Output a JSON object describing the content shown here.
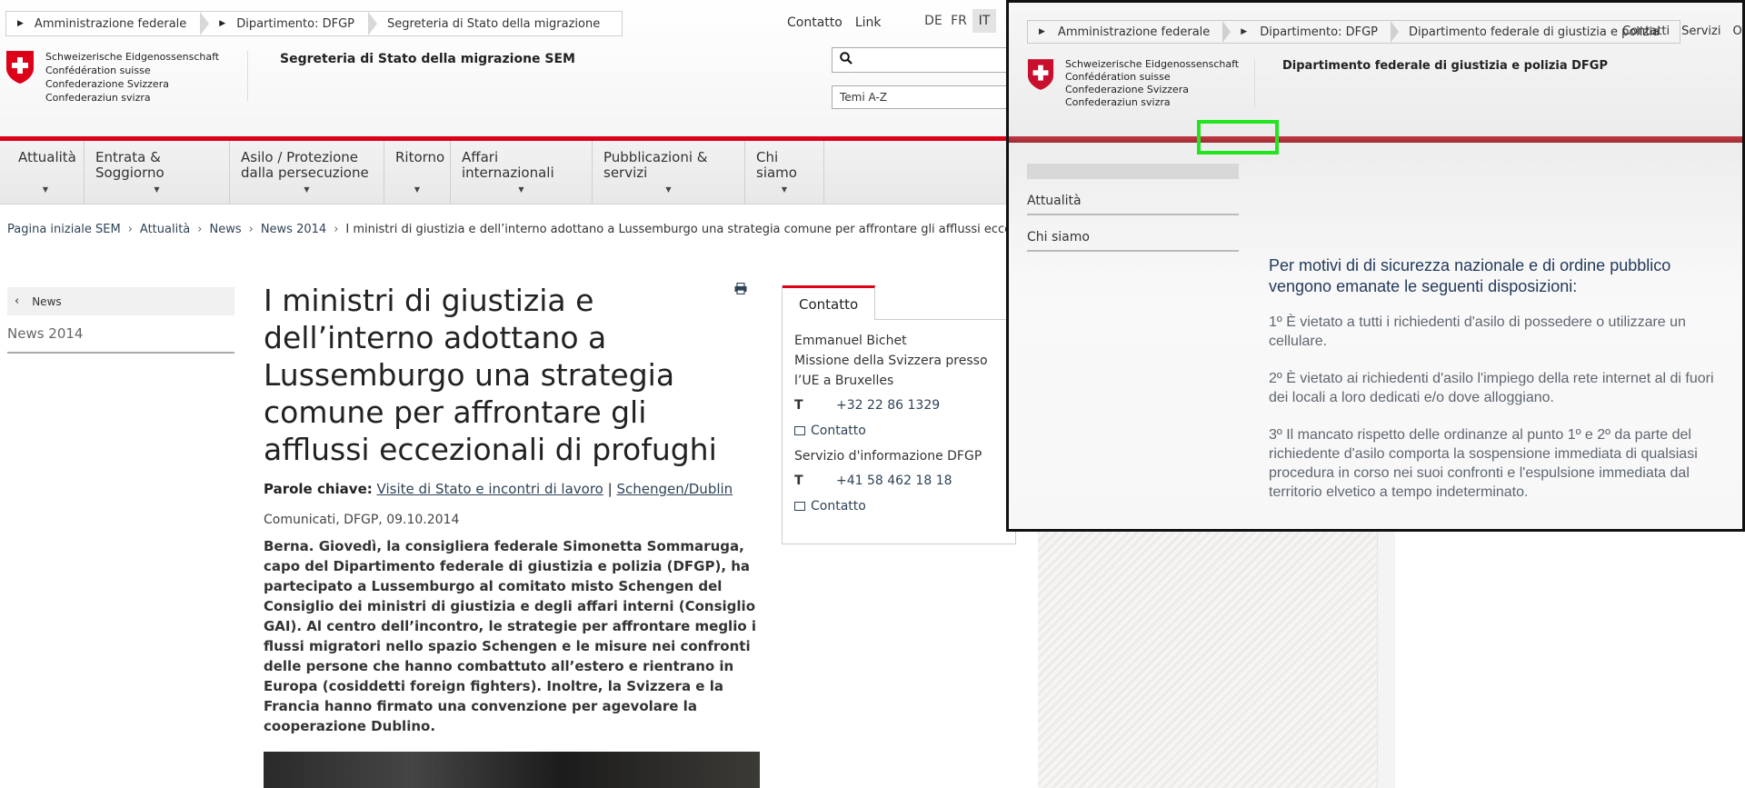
{
  "header": {
    "top_breadcrumb": [
      "Amministrazione federale",
      "Dipartimento: DFGP",
      "Segreteria di Stato della migrazione"
    ],
    "top_links": [
      "Contatto",
      "Link"
    ],
    "languages": [
      "DE",
      "FR",
      "IT"
    ],
    "federation_names": [
      "Schweizerische Eidgenossenschaft",
      "Confédération suisse",
      "Confederazione Svizzera",
      "Confederaziun svizra"
    ],
    "department_title": "Segreteria di Stato della migrazione SEM",
    "search_placeholder": "",
    "topics_select": "Temi A-Z"
  },
  "nav": {
    "items": [
      "Attualità",
      "Entrata & Soggiorno",
      "Asilo / Protezione dalla persecuzione",
      "Ritorno",
      "Affari internazionali",
      "Pubblicazioni & servizi",
      "Chi siamo"
    ]
  },
  "breadcrumb": {
    "items": [
      "Pagina iniziale SEM",
      "Attualità",
      "News",
      "News 2014"
    ],
    "current": "I ministri di giustizia e dell’interno adottano a Lussemburgo una strategia comune per affrontare gli afflussi eccezionali di profughi"
  },
  "sidebar": {
    "back_label": "News",
    "current_label": "News 2014"
  },
  "article": {
    "title": "I ministri di giustizia e dell’interno adottano a Lussemburgo una strategia comune per affrontare gli afflussi eccezionali di profughi",
    "keywords_label": "Parole chiave:",
    "keyword_1": "Visite di Stato e incontri di lavoro",
    "keyword_separator": " | ",
    "keyword_2": "Schengen/Dublin",
    "meta": "Comunicati, DFGP, 09.10.2014",
    "lead": "Berna. Giovedì, la consigliera federale Simonetta Sommaruga, capo del Dipartimento federale di giustizia e polizia (DFGP), ha partecipato a Lussemburgo al comitato misto Schengen del Consiglio dei ministri di giustizia e degli affari interni (Consiglio GAI). Al centro dell’incontro, le strategie per affrontare meglio i flussi migratori nello spazio Schengen e le misure nei confronti delle persone che hanno combattuto all’estero e rientrano in Europa (cosiddetti foreign fighters). Inoltre, la Svizzera e la Francia hanno firmato una convenzione per agevolare la cooperazione Dublino."
  },
  "contact": {
    "tab_label": "Contatto",
    "name": "Emmanuel Bichet",
    "org": "Missione della Svizzera presso l’UE a Bruxelles",
    "phone_label_1": "T",
    "phone_1": "+32 22 86 1329",
    "link_label_1": "Contatto",
    "service": "Servizio d'informazione DFGP",
    "phone_label_2": "T",
    "phone_2": "+41 58 462 18 18",
    "link_label_2": "Contatto"
  },
  "overlay": {
    "breadcrumb": [
      "Amministrazione federale",
      "Dipartimento: DFGP",
      "Dipartimento federale di giustizia e polizia"
    ],
    "top_links": [
      "Contatti",
      "Servizi",
      "Offerte"
    ],
    "federation_names": [
      "Schweizerische Eidgenossenschaft",
      "Confédération suisse",
      "Confederazione Svizzera",
      "Confederaziun svizra"
    ],
    "department_title": "Dipartimento federale di giustizia e polizia DFGP",
    "side_items": [
      "Attualità",
      "Chi siamo"
    ],
    "notice_heading": "Per motivi di di sicurezza nazionale e di ordine pubblico vengono emanate le seguenti disposizioni:",
    "notice_items": [
      "1º È vietato a tutti i richiedenti d'asilo di possedere o utilizzare un cellulare.",
      "2º È vietato ai richiedenti d'asilo l'impiego della rete internet al di fuori dei locali a loro dedicati e/o dove alloggiano.",
      "3º Il mancato rispetto delle ordinanze al punto 1º e 2º da parte del richiedente d'asilo comporta la sospensione immediata di qualsiasi procedura in corso nei suoi confronti e l'espulsione immediata dal territorio elvetico a tempo indeterminato."
    ],
    "highlight_color": "#22e51f"
  },
  "colors": {
    "accent_red": "#dc0018",
    "link_blue": "#2f4356"
  },
  "icons": [
    "swiss-shield-icon",
    "search-icon",
    "chevron-down-icon",
    "back-arrow-icon",
    "print-icon",
    "mail-icon",
    "triangle-right-icon"
  ]
}
